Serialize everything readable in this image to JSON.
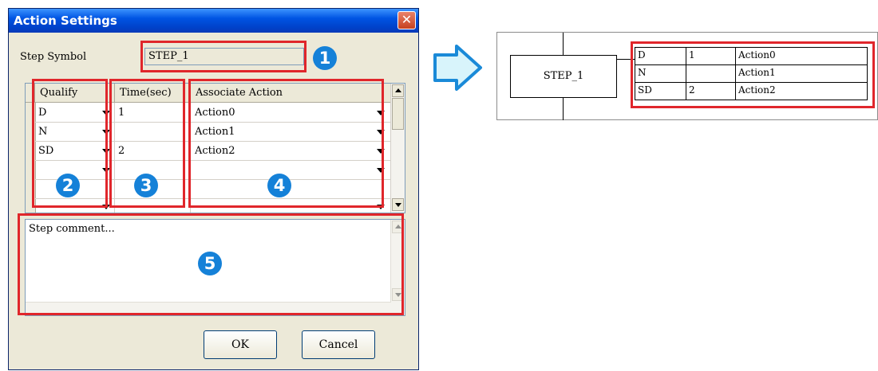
{
  "dialog": {
    "title": "Action Settings",
    "close_glyph": "✕",
    "step_symbol_label": "Step Symbol",
    "step_symbol_value": "STEP_1",
    "grid": {
      "headers": [
        "Qualify",
        "Time(sec)",
        "Associate Action"
      ],
      "rows": [
        {
          "qualify": "D",
          "time": "1",
          "action": "Action0"
        },
        {
          "qualify": "N",
          "time": "",
          "action": "Action1"
        },
        {
          "qualify": "SD",
          "time": "2",
          "action": "Action2"
        },
        {
          "qualify": "",
          "time": "",
          "action": ""
        }
      ]
    },
    "comment_placeholder": "Step comment...",
    "ok_label": "OK",
    "cancel_label": "Cancel"
  },
  "badges": [
    "1",
    "2",
    "3",
    "4",
    "5"
  ],
  "diagram": {
    "step_label": "STEP_1",
    "rows": [
      {
        "qualify": "D",
        "time": "1",
        "action": "Action0"
      },
      {
        "qualify": "N",
        "time": "",
        "action": "Action1"
      },
      {
        "qualify": "SD",
        "time": "2",
        "action": "Action2"
      }
    ]
  },
  "colors": {
    "highlight": "#e0262b",
    "badge": "#1581d8",
    "arrow_fill": "#d8f4fb",
    "arrow_stroke": "#1a8ad8"
  },
  "icons": [
    "close-icon",
    "dropdown-arrow-icon",
    "scroll-up-icon",
    "scroll-down-icon",
    "right-arrow-icon"
  ]
}
